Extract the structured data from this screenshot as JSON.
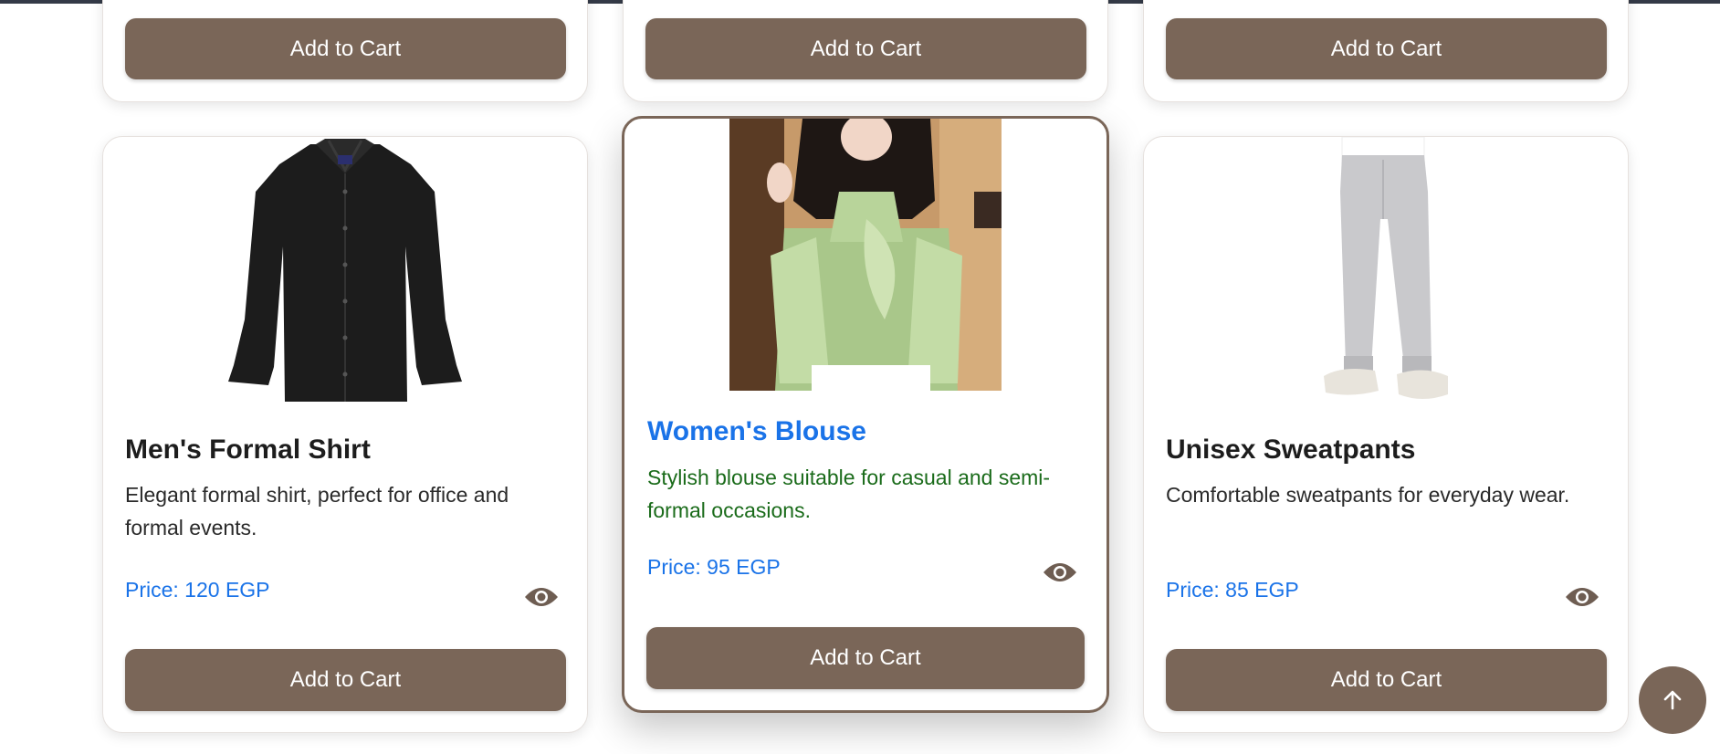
{
  "top_row": {
    "buttons": [
      "Add to Cart",
      "Add to Cart",
      "Add to Cart"
    ]
  },
  "products": [
    {
      "name": "Men's Formal Shirt",
      "description": "Elegant formal shirt, perfect for office and formal events.",
      "price": "Price: 120 EGP",
      "button": "Add to Cart",
      "image_icon": "black-shirt-image"
    },
    {
      "name": "Women's Blouse",
      "description": "Stylish blouse suitable for casual and semi-formal occasions.",
      "price": "Price: 95 EGP",
      "button": "Add to Cart",
      "image_icon": "blouse-image"
    },
    {
      "name": "Unisex Sweatpants",
      "description": "Comfortable sweatpants for everyday wear.",
      "price": "Price: 85 EGP",
      "button": "Add to Cart",
      "image_icon": "sweatpants-image"
    }
  ],
  "icons": {
    "view": "eye-icon",
    "scroll_top": "arrow-up-icon"
  },
  "colors": {
    "accent": "#7a6658",
    "price": "#1a73e8",
    "active_title": "#1a73e8",
    "active_description": "#1a6b1a"
  }
}
